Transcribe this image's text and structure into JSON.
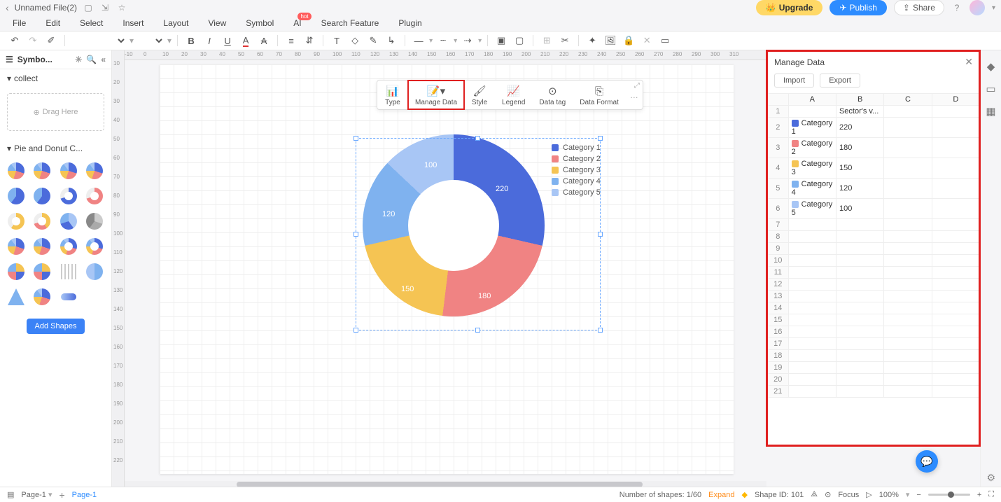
{
  "topbar": {
    "title": "Unnamed File(2)",
    "upgrade": "Upgrade",
    "publish": "Publish",
    "share": "Share"
  },
  "menubar": {
    "file": "File",
    "edit": "Edit",
    "select": "Select",
    "insert": "Insert",
    "layout": "Layout",
    "view": "View",
    "symbol": "Symbol",
    "ai": "AI",
    "ai_badge": "hot",
    "search": "Search Feature",
    "plugin": "Plugin"
  },
  "sidebar": {
    "title": "Symbo...",
    "collect": "collect",
    "drag": "Drag Here",
    "section": "Pie and Donut C...",
    "addshapes": "Add Shapes"
  },
  "chart_toolbar": {
    "type": "Type",
    "manage": "Manage Data",
    "style": "Style",
    "legend": "Legend",
    "datatag": "Data tag",
    "dataformat": "Data Format"
  },
  "chart_data": {
    "type": "pie",
    "title": "Sector's v...",
    "series": [
      {
        "name": "Category 1",
        "value": 220,
        "color": "#4b6bdb"
      },
      {
        "name": "Category 2",
        "value": 180,
        "color": "#f08383"
      },
      {
        "name": "Category 3",
        "value": 150,
        "color": "#f5c453"
      },
      {
        "name": "Category 4",
        "value": 120,
        "color": "#7fb2ef"
      },
      {
        "name": "Category 5",
        "value": 100,
        "color": "#a8c6f5"
      }
    ]
  },
  "panel": {
    "title": "Manage Data",
    "import": "Import",
    "export": "Export",
    "columns": [
      "A",
      "B",
      "C",
      "D"
    ],
    "row1_header": "Sector's v...",
    "rows": [
      {
        "n": 1
      },
      {
        "n": 2,
        "cat": "Category 1",
        "val": "220",
        "color": "#4b6bdb"
      },
      {
        "n": 3,
        "cat": "Category 2",
        "val": "180",
        "color": "#f08383"
      },
      {
        "n": 4,
        "cat": "Category 3",
        "val": "150",
        "color": "#f5c453"
      },
      {
        "n": 5,
        "cat": "Category 4",
        "val": "120",
        "color": "#7fb2ef"
      },
      {
        "n": 6,
        "cat": "Category 5",
        "val": "100",
        "color": "#a8c6f5"
      },
      {
        "n": 7
      },
      {
        "n": 8
      },
      {
        "n": 9
      },
      {
        "n": 10
      },
      {
        "n": 11
      },
      {
        "n": 12
      },
      {
        "n": 13
      },
      {
        "n": 14
      },
      {
        "n": 15
      },
      {
        "n": 16
      },
      {
        "n": 17
      },
      {
        "n": 18
      },
      {
        "n": 19
      },
      {
        "n": 20
      },
      {
        "n": 21
      }
    ]
  },
  "footer": {
    "page_select": "Page-1",
    "tab": "Page-1",
    "shapes_count": "Number of shapes: 1/60",
    "expand": "Expand",
    "shape_id": "Shape ID: 101",
    "focus": "Focus",
    "zoom": "100%"
  },
  "ruler_h": [
    "-10",
    "0",
    "10",
    "20",
    "30",
    "40",
    "50",
    "60",
    "70",
    "80",
    "90",
    "100",
    "110",
    "120",
    "130",
    "140",
    "150",
    "160",
    "170",
    "180",
    "190",
    "200",
    "210",
    "220",
    "230",
    "240",
    "250",
    "260",
    "270",
    "280",
    "290",
    "300",
    "310"
  ],
  "ruler_v": [
    "10",
    "20",
    "30",
    "40",
    "50",
    "60",
    "70",
    "80",
    "90",
    "100",
    "110",
    "120",
    "130",
    "140",
    "150",
    "160",
    "170",
    "180",
    "190",
    "200",
    "210",
    "220"
  ]
}
